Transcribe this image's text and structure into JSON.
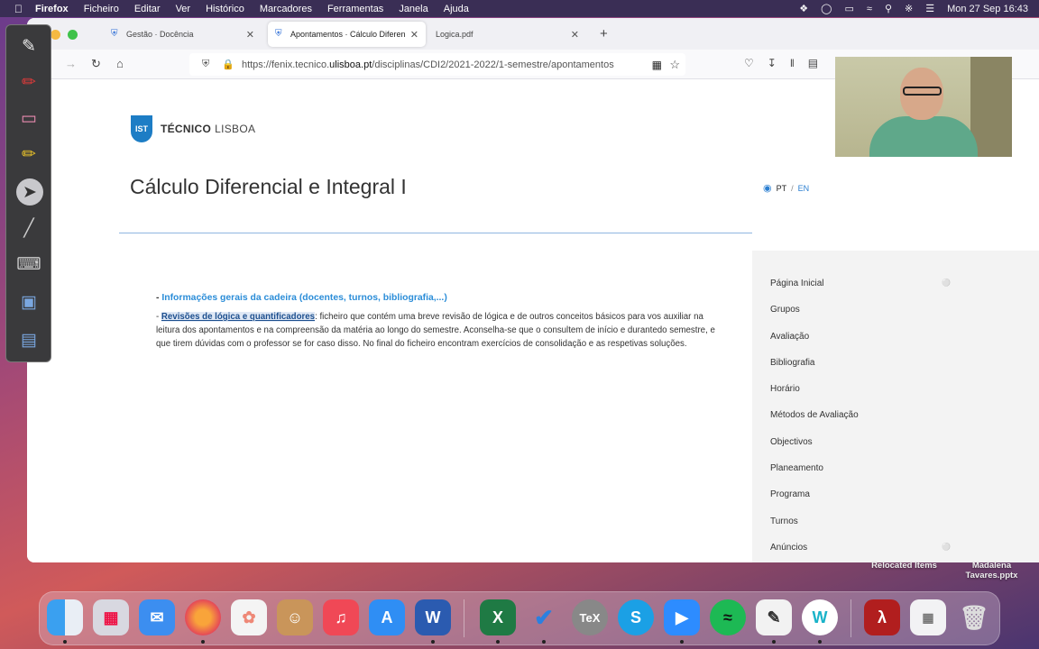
{
  "menubar": {
    "app": "Firefox",
    "items": [
      "Ficheiro",
      "Editar",
      "Ver",
      "Histórico",
      "Marcadores",
      "Ferramentas",
      "Janela",
      "Ajuda"
    ],
    "clock": "Mon 27 Sep  16:43"
  },
  "tabs": [
    {
      "title": "Gestão · Docência"
    },
    {
      "title": "Apontamentos · Cálculo Diferen"
    },
    {
      "title": "Logica.pdf"
    }
  ],
  "urlbar": {
    "prefix": "https://fenix.tecnico.",
    "domain": "ulisboa.pt",
    "suffix": "/disciplinas/CDI2/2021-2022/1-semestre/apontamentos"
  },
  "page": {
    "logo_bold": "TÉCNICO",
    "logo_light": "LISBOA",
    "title": "Cálculo Diferencial e Integral I",
    "lang_pt": "PT",
    "lang_sep": "/",
    "lang_en": "EN",
    "info_dash": "- ",
    "info_link": "Informações gerais da cadeira (docentes, turnos, bibliografia,...)",
    "rev_dash": "- ",
    "rev_link": "Revisões de lógica e quantificadores",
    "rev_text": ": ficheiro que contém uma breve revisão de lógica e de outros conceitos básicos para vos auxiliar na leitura dos apontamentos e  na compreensão da matéria ao longo do semestre. Aconselha-se que o consultem de início e durantedo semestre, e que tirem dúvidas com o professor se for caso disso. No final do ficheiro encontram exercícios de consolidação e as respetivas soluções."
  },
  "sidemenu": [
    {
      "label": "Página Inicial",
      "rss": true
    },
    {
      "label": "Grupos"
    },
    {
      "label": "Avaliação"
    },
    {
      "label": "Bibliografia"
    },
    {
      "label": "Horário"
    },
    {
      "label": "Métodos de Avaliação"
    },
    {
      "label": "Objectivos"
    },
    {
      "label": "Planeamento"
    },
    {
      "label": "Programa"
    },
    {
      "label": "Turnos"
    },
    {
      "label": "Anúncios",
      "rss": true
    }
  ],
  "desktop": {
    "item1": "Relocated Items",
    "item2_line1": "Madalena",
    "item2_line2": "Tavares.pptx"
  },
  "colors": {
    "accent": "#2b8dd8",
    "link_dark": "#1d4f8e",
    "logo_blue": "#1d7dc5"
  },
  "dock": [
    "finder-icon",
    "launchpad-icon",
    "mail-icon",
    "firefox-icon",
    "photos-icon",
    "contacts-icon",
    "music-icon",
    "app-store-icon",
    "word-icon",
    "excel-icon",
    "vscode-icon",
    "tex-icon",
    "skype-icon",
    "zoom-icon",
    "spotify-icon",
    "annotation-app-icon",
    "unknown-w-icon",
    "acrobat-icon",
    "preview-icon",
    "trash-icon"
  ]
}
